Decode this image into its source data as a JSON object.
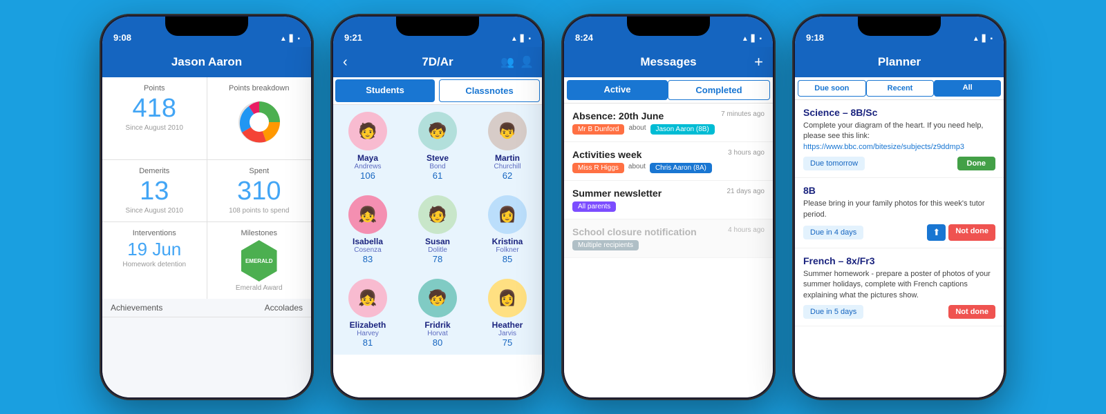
{
  "phones": [
    {
      "id": "phone1",
      "time": "9:08",
      "title": "Jason Aaron",
      "nav_back": false,
      "nav_plus": false,
      "sections": {
        "points_label": "Points",
        "points_value": "418",
        "points_sub": "Since August 2010",
        "breakdown_label": "Points breakdown",
        "demerits_label": "Demerits",
        "demerits_value": "13",
        "demerits_sub": "Since August 2010",
        "spent_label": "Spent",
        "spent_value": "310",
        "spent_sub": "108 points to spend",
        "interventions_label": "Interventions",
        "interventions_value": "19 Jun",
        "interventions_sub": "Homework detention",
        "milestones_label": "Milestones",
        "emerald_text": "EMERALD",
        "emerald_sub": "Emerald Award",
        "achievements_label": "Achievements",
        "accolades_label": "Accolades"
      }
    },
    {
      "id": "phone2",
      "time": "9:21",
      "title": "7D/Ar",
      "nav_back": true,
      "tabs": [
        {
          "label": "Students",
          "active": true
        },
        {
          "label": "Classnotes",
          "active": false
        }
      ],
      "students": [
        {
          "name": "Maya",
          "surname": "Andrews",
          "points": "106",
          "color": "#f48fb1"
        },
        {
          "name": "Steve",
          "surname": "Bond",
          "points": "61",
          "color": "#80cbc4"
        },
        {
          "name": "Martin",
          "surname": "Churchill",
          "points": "62",
          "color": "#bcaaa4"
        },
        {
          "name": "Isabella",
          "surname": "Cosenza",
          "points": "83",
          "color": "#f48fb1"
        },
        {
          "name": "Susan",
          "surname": "Dolitle",
          "points": "78",
          "color": "#a5d6a7"
        },
        {
          "name": "Kristina",
          "surname": "Folkner",
          "points": "85",
          "color": "#90caf9"
        },
        {
          "name": "Elizabeth",
          "surname": "Harvey",
          "points": "81",
          "color": "#f48fb1"
        },
        {
          "name": "Fridrik",
          "surname": "Horvat",
          "points": "80",
          "color": "#80cbc4"
        },
        {
          "name": "Heather",
          "surname": "Jarvis",
          "points": "75",
          "color": "#ffcc80"
        }
      ]
    },
    {
      "id": "phone3",
      "time": "8:24",
      "title": "Messages",
      "nav_plus": true,
      "tabs": [
        {
          "label": "Active",
          "active": true
        },
        {
          "label": "Completed",
          "active": false
        }
      ],
      "messages": [
        {
          "title": "Absence: 20th June",
          "time": "7 minutes ago",
          "sender": "Mr B Dunford",
          "about": "about",
          "recipient": "Jason Aaron (8B)",
          "sender_color": "tag-orange",
          "recipient_color": "tag-cyan"
        },
        {
          "title": "Activities week",
          "time": "3 hours ago",
          "sender": "Miss R Higgs",
          "about": "about",
          "recipient": "Chris Aaron (8A)",
          "sender_color": "tag-orange",
          "recipient_color": "tag-blue"
        },
        {
          "title": "Summer newsletter",
          "time": "21 days ago",
          "sender": "All parents",
          "sender_color": "tag-purple",
          "recipient": null
        },
        {
          "title": "School closure notification",
          "time": "4 hours ago",
          "sender": "Multiple recipients",
          "sender_color": "tag-gray",
          "recipient": null,
          "dimmed": true
        }
      ]
    },
    {
      "id": "phone4",
      "time": "9:18",
      "title": "Planner",
      "tabs": [
        {
          "label": "Due soon",
          "active": false
        },
        {
          "label": "Recent",
          "active": false
        },
        {
          "label": "All",
          "active": true
        }
      ],
      "planner_items": [
        {
          "subject": "Science – 8B/Sc",
          "description": "Complete your diagram of the heart. If you need help, please see this link: ",
          "link_text": "https://www.bbc.com/bitesize/subjects/z9ddmp3",
          "due": "Due tomorrow",
          "action": "Done",
          "action_type": "done"
        },
        {
          "subject": "8B",
          "description": "Please bring in your family photos for this week's tutor period.",
          "link_text": null,
          "due": "Due in 4 days",
          "action": "Not done",
          "action_type": "not-done",
          "has_upload": true
        },
        {
          "subject": "French – 8x/Fr3",
          "description": "Summer homework - prepare a poster of photos of your summer holidays, complete with French captions explaining what the pictures show.",
          "link_text": null,
          "due": "Due in 5 days",
          "action": "Not done",
          "action_type": "not-done"
        }
      ]
    }
  ]
}
